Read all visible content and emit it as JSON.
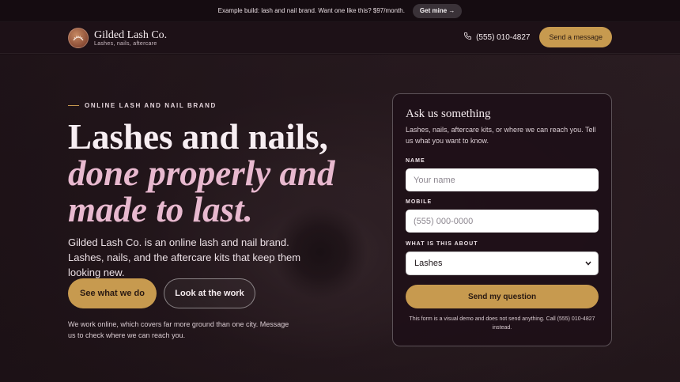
{
  "promo": {
    "text": "Example build: lash and nail brand. Want one like this? $97/month.",
    "cta": "Get mine →"
  },
  "header": {
    "brand_name": "Gilded Lash Co.",
    "brand_tagline": "Lashes, nails, aftercare",
    "phone": "(555) 010-4827",
    "cta": "Send a message",
    "icons": [
      "logo-icon",
      "phone-icon"
    ]
  },
  "hero": {
    "eyebrow": "ONLINE LASH AND NAIL BRAND",
    "headline_plain": "Lashes and nails, ",
    "headline_accent": "done properly and made to last.",
    "lead": "Gilded Lash Co. is an online lash and nail brand. Lashes, nails, and the aftercare kits that keep them looking new.",
    "primary_cta": "See what we do",
    "secondary_cta": "Look at the work",
    "note": "We work online, which covers far more ground than one city. Message us to check where we can reach you."
  },
  "form": {
    "title": "Ask us something",
    "subtitle": "Lashes, nails, aftercare kits, or where we can reach you. Tell us what you want to know.",
    "name_label": "NAME",
    "name_placeholder": "Your name",
    "mobile_label": "MOBILE",
    "mobile_placeholder": "(555) 000-0000",
    "topic_label": "WHAT IS THIS ABOUT",
    "topic_value": "Lashes",
    "submit": "Send my question",
    "disclaimer": "This form is a visual demo and does not send anything. Call (555) 010-4827 instead."
  },
  "colors": {
    "accent_gold": "#c79a4f",
    "accent_pink": "#e8b9cf",
    "background": "#1a0f14"
  }
}
